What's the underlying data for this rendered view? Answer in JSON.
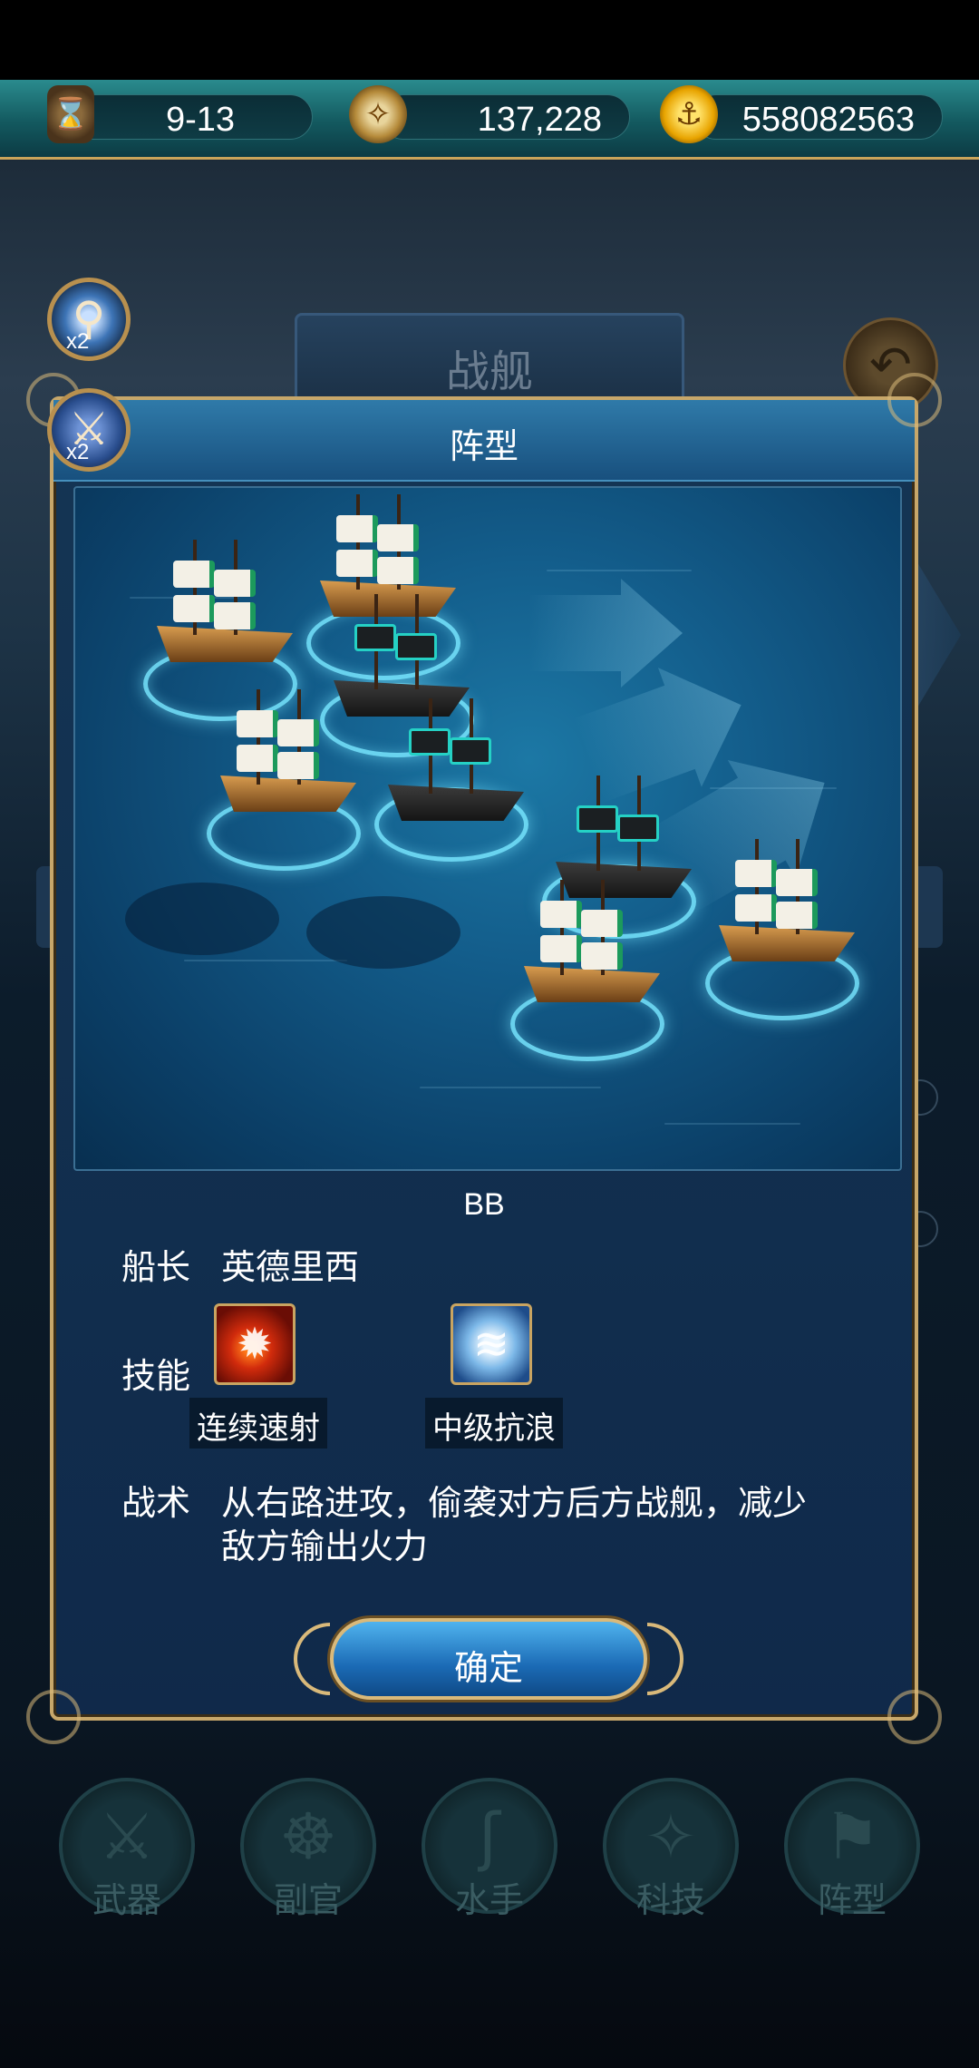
{
  "resources": [
    {
      "icon": "hourglass-icon",
      "value": "9-13"
    },
    {
      "icon": "compass-icon",
      "value": "137,228"
    },
    {
      "icon": "gold-anchor-coin-icon",
      "value": "558082563"
    }
  ],
  "background_screen": {
    "title": "战舰",
    "zoom_badge": "x2",
    "battle_badge": "x2"
  },
  "bottom_menu": [
    {
      "label": "武器",
      "icon": "sword-icon"
    },
    {
      "label": "副官",
      "icon": "ship-wheel-icon"
    },
    {
      "label": "水手",
      "icon": "hook-icon"
    },
    {
      "label": "科技",
      "icon": "compass-icon"
    },
    {
      "label": "阵型",
      "icon": "flag-icon"
    }
  ],
  "modal": {
    "title": "阵型",
    "ship_name": "BB",
    "captain_label": "船长",
    "captain_value": "英德里西",
    "skills_label": "技能",
    "skills": [
      {
        "name": "连续速射",
        "icon": "rapid-fire-skill-icon"
      },
      {
        "name": "中级抗浪",
        "icon": "wave-resist-skill-icon"
      }
    ],
    "tactic_label": "战术",
    "tactic_lines": [
      "从右路进攻，偷袭对方后方战舰，减少",
      "敌方输出火力"
    ],
    "confirm_label": "确定"
  },
  "colors": {
    "frame_gold": "#c7a76a",
    "ring_cyan": "#78e6ff",
    "title_bar": "#2f7aa9",
    "resource_bar": "#13595f"
  }
}
